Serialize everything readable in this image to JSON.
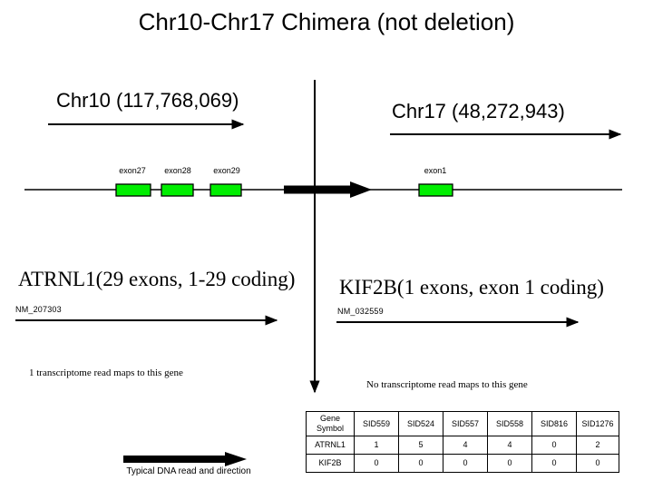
{
  "title": "Chr10-Chr17 Chimera (not deletion)",
  "chromosomes": {
    "left": {
      "label": "Chr10 (117,768,069)"
    },
    "right": {
      "label": "Chr17 (48,272,943)"
    }
  },
  "exons": {
    "left": [
      {
        "label": "exon27"
      },
      {
        "label": "exon28"
      },
      {
        "label": "exon29"
      }
    ],
    "right": [
      {
        "label": "exon1"
      }
    ]
  },
  "genes": {
    "left": {
      "symbol": "ATRNL1",
      "detail": "(29 exons, 1-29 coding)",
      "accession": "NM_207303",
      "read_note": "1 transcriptome read maps to this gene"
    },
    "right": {
      "symbol": "KIF2B",
      "detail": "(1 exons, exon 1 coding)",
      "accession": "NM_032559",
      "read_note": "No transcriptome read maps to this gene"
    }
  },
  "legend": {
    "caption": "Typical DNA read and direction"
  },
  "table": {
    "headers": [
      "Gene Symbol",
      "SID559",
      "SID524",
      "SID557",
      "SID558",
      "SID816",
      "SID1276"
    ],
    "rows": [
      {
        "gene": "ATRNL1",
        "values": [
          "1",
          "5",
          "4",
          "4",
          "0",
          "2"
        ]
      },
      {
        "gene": "KIF2B",
        "values": [
          "0",
          "0",
          "0",
          "0",
          "0",
          "0"
        ]
      }
    ]
  },
  "colors": {
    "exon_fill": "#00EE00",
    "exon_stroke": "#000000",
    "line": "#000000",
    "background": "#FFFFFF"
  }
}
